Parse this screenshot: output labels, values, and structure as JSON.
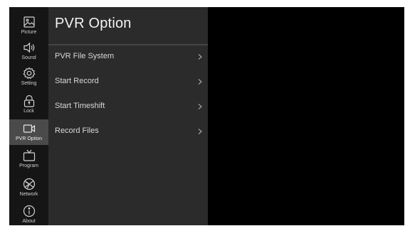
{
  "sidebar": {
    "items": [
      {
        "label": "Picture",
        "icon": "picture-icon",
        "active": false
      },
      {
        "label": "Sound",
        "icon": "speaker-icon",
        "active": false
      },
      {
        "label": "Setting",
        "icon": "gear-icon",
        "active": false
      },
      {
        "label": "Lock",
        "icon": "lock-icon",
        "active": false
      },
      {
        "label": "PVR Option",
        "icon": "video-camera-icon",
        "active": true
      },
      {
        "label": "Program",
        "icon": "tv-icon",
        "active": false
      },
      {
        "label": "Network",
        "icon": "globe-icon",
        "active": false
      },
      {
        "label": "About",
        "icon": "info-icon",
        "active": false
      }
    ]
  },
  "panel": {
    "title": "PVR Option",
    "items": [
      {
        "label": "PVR File System"
      },
      {
        "label": "Start Record"
      },
      {
        "label": "Start Timeshift"
      },
      {
        "label": "Record Files"
      }
    ]
  },
  "colors": {
    "sidebar_bg": "#151515",
    "sidebar_active_bg": "#4a4a4a",
    "panel_bg": "#2b2b2b",
    "video_bg": "#000000",
    "text": "#d8d8d8"
  }
}
